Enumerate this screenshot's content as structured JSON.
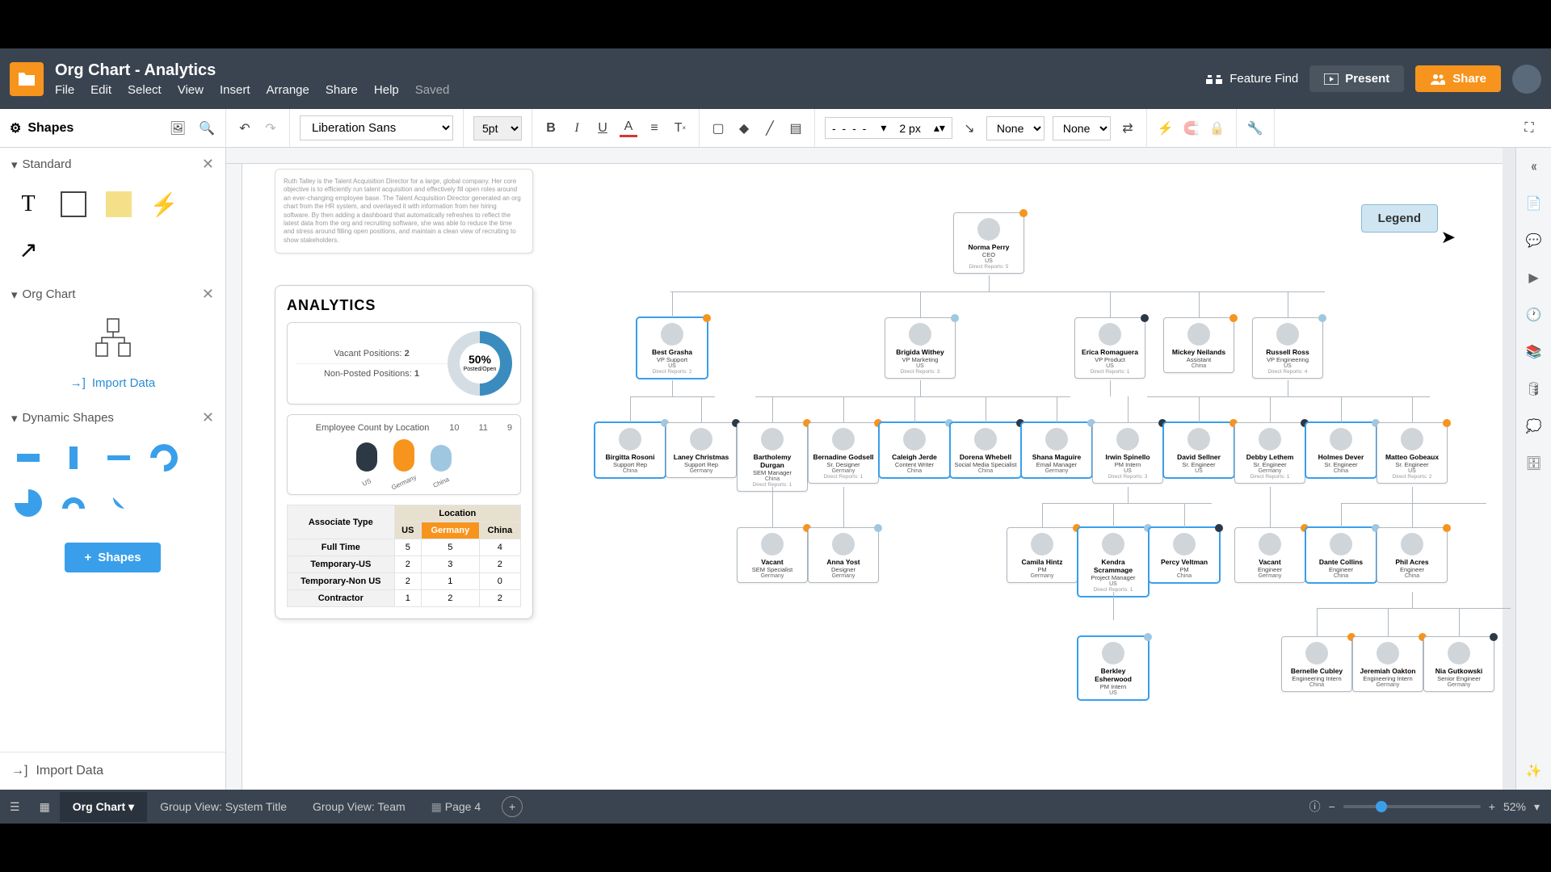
{
  "doc_title": "Org Chart - Analytics",
  "menu": [
    "File",
    "Edit",
    "Select",
    "View",
    "Insert",
    "Arrange",
    "Share",
    "Help"
  ],
  "saved_label": "Saved",
  "header": {
    "feature_find": "Feature Find",
    "present": "Present",
    "share": "Share"
  },
  "toolbar": {
    "shapes": "Shapes",
    "font": "Liberation Sans",
    "size": "5pt",
    "line_width": "2 px",
    "fill": "None",
    "stroke": "None"
  },
  "sidebar": {
    "standard": "Standard",
    "org_chart": "Org Chart",
    "import_data": "Import Data",
    "dynamic_shapes": "Dynamic Shapes",
    "add_shapes": "Shapes",
    "import_data_bottom": "Import Data"
  },
  "sticky_text": "Ruth Talley is the Talent Acquisition Director for a large, global company. Her core objective is to efficiently run talent acquisition and effectively fill open roles around an ever-changing employee base. The Talent Acquisition Director generated an org chart from the HR system, and overlayed it with information from her hiring software. By then adding a dashboard that automatically refreshes to reflect the latest data from the org and recruiting software, she was able to reduce the time and stress around filling open positions, and maintain a clean view of recruiting to show stakeholders.",
  "analytics": {
    "title": "ANALYTICS",
    "vacant_label": "Vacant Positions:",
    "vacant_value": "2",
    "nonposted_label": "Non-Posted Positions:",
    "nonposted_value": "1",
    "donut_pct": "50%",
    "donut_sub": "Posted/Open",
    "emp_count_label": "Employee Count by Location",
    "emp_counts": [
      "10",
      "11",
      "9"
    ],
    "emp_locs": [
      "US",
      "Germany",
      "China"
    ]
  },
  "loc_table": {
    "location_header": "Location",
    "assoc_type": "Associate Type",
    "cols": [
      "US",
      "Germany",
      "China"
    ],
    "rows": [
      {
        "label": "Full Time",
        "vals": [
          "5",
          "5",
          "4"
        ]
      },
      {
        "label": "Temporary-US",
        "vals": [
          "2",
          "3",
          "2"
        ]
      },
      {
        "label": "Temporary-Non US",
        "vals": [
          "2",
          "1",
          "0"
        ]
      },
      {
        "label": "Contractor",
        "vals": [
          "1",
          "2",
          "2"
        ]
      }
    ]
  },
  "chart_data": {
    "type": "bar",
    "title": "Employee Count by Location",
    "categories": [
      "US",
      "Germany",
      "China"
    ],
    "values": [
      10,
      11,
      9
    ],
    "colors": [
      "#2d3845",
      "#f7941d",
      "#9fc8e0"
    ],
    "ylim": [
      0,
      12
    ]
  },
  "legend_label": "Legend",
  "org": {
    "ceo": {
      "name": "Norma Perry",
      "role": "CEO",
      "loc": "US",
      "dr": "Direct Reports: 5"
    },
    "row2": [
      {
        "name": "Best Grasha",
        "role": "VP Support",
        "loc": "US",
        "dr": "Direct Reports: 2",
        "dot": "#f7941d"
      },
      {
        "name": "Brigida Withey",
        "role": "VP Marketing",
        "loc": "US",
        "dr": "Direct Reports: 3",
        "dot": "#9fc8e0"
      },
      {
        "name": "Erica Romaguera",
        "role": "VP Product",
        "loc": "US",
        "dr": "Direct Reports: 1",
        "dot": "#2d3845"
      },
      {
        "name": "Mickey Neilands",
        "role": "Assistant",
        "loc": "China",
        "dr": "",
        "dot": "#f7941d"
      },
      {
        "name": "Russell Ross",
        "role": "VP Engineering",
        "loc": "US",
        "dr": "Direct Reports: 4",
        "dot": "#9fc8e0"
      }
    ],
    "row3": [
      {
        "name": "Birgitta Rosoni",
        "role": "Support Rep",
        "loc": "China",
        "dr": "",
        "dot": "#9fc8e0"
      },
      {
        "name": "Laney Christmas",
        "role": "Support Rep",
        "loc": "Germany",
        "dr": "",
        "dot": "#2d3845"
      },
      {
        "name": "Bartholemy Durgan",
        "role": "SEM Manager",
        "loc": "China",
        "dr": "Direct Reports: 1",
        "dot": "#f7941d"
      },
      {
        "name": "Bernadine Godsell",
        "role": "Sr. Designer",
        "loc": "Germany",
        "dr": "Direct Reports: 1",
        "dot": "#f7941d"
      },
      {
        "name": "Caleigh Jerde",
        "role": "Content Writer",
        "loc": "China",
        "dr": "",
        "dot": "#9fc8e0"
      },
      {
        "name": "Dorena Whebell",
        "role": "Social Media Specialist",
        "loc": "China",
        "dr": "",
        "dot": "#2d3845"
      },
      {
        "name": "Shana Maguire",
        "role": "Email Manager",
        "loc": "Germany",
        "dr": "",
        "dot": "#9fc8e0"
      },
      {
        "name": "Irwin Spinello",
        "role": "PM Intern",
        "loc": "US",
        "dr": "Direct Reports: 3",
        "dot": "#2d3845"
      },
      {
        "name": "David Sellner",
        "role": "Sr. Engineer",
        "loc": "US",
        "dr": "",
        "dot": "#f7941d"
      },
      {
        "name": "Debby Lethem",
        "role": "Sr. Engineer",
        "loc": "Germany",
        "dr": "Direct Reports: 1",
        "dot": "#2d3845"
      },
      {
        "name": "Holmes Dever",
        "role": "Sr. Engineer",
        "loc": "China",
        "dr": "",
        "dot": "#9fc8e0"
      },
      {
        "name": "Matteo Gobeaux",
        "role": "Sr. Engineer",
        "loc": "US",
        "dr": "Direct Reports: 2",
        "dot": "#f7941d"
      }
    ],
    "row4": [
      {
        "name": "Vacant",
        "role": "SEM Specialist",
        "loc": "Germany",
        "dr": "",
        "dot": "#f7941d"
      },
      {
        "name": "Anna Yost",
        "role": "Designer",
        "loc": "Germany",
        "dr": "",
        "dot": "#9fc8e0"
      },
      {
        "name": "Camila Hintz",
        "role": "PM",
        "loc": "Germany",
        "dr": "",
        "dot": "#f7941d"
      },
      {
        "name": "Kendra Scrammage",
        "role": "Project Manager",
        "loc": "US",
        "dr": "Direct Reports: 1",
        "dot": "#9fc8e0"
      },
      {
        "name": "Percy Veltman",
        "role": "PM",
        "loc": "China",
        "dr": "",
        "dot": "#2d3845"
      },
      {
        "name": "Vacant",
        "role": "Engineer",
        "loc": "Germany",
        "dr": "",
        "dot": "#f7941d"
      },
      {
        "name": "Dante Collins",
        "role": "Engineer",
        "loc": "China",
        "dr": "",
        "dot": "#9fc8e0"
      },
      {
        "name": "Phil Acres",
        "role": "Engineer",
        "loc": "China",
        "dr": "",
        "dot": "#f7941d"
      }
    ],
    "row5": [
      {
        "name": "Berkley Esherwood",
        "role": "PM Intern",
        "loc": "US",
        "dr": "",
        "dot": "#9fc8e0"
      },
      {
        "name": "Bernelle Cubley",
        "role": "Engineering Intern",
        "loc": "China",
        "dr": "",
        "dot": "#f7941d"
      },
      {
        "name": "Jeremiah Oakton",
        "role": "Engineering Intern",
        "loc": "Germany",
        "dr": "",
        "dot": "#f7941d"
      },
      {
        "name": "Nia Gutkowski",
        "role": "Senior Engineer",
        "loc": "Germany",
        "dr": "",
        "dot": "#2d3845"
      }
    ]
  },
  "tabs": [
    "Org Chart",
    "Group View: System Title",
    "Group View: Team",
    "Page 4"
  ],
  "zoom": "52%"
}
